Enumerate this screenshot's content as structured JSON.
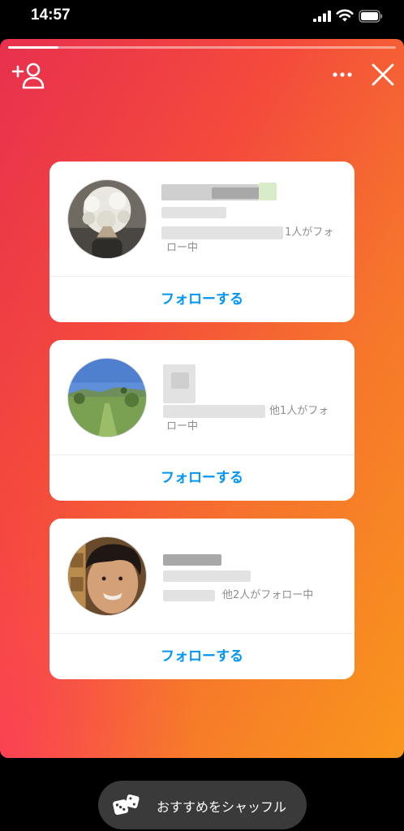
{
  "status_bar": {
    "time": "14:57"
  },
  "story": {
    "progress": 0.13,
    "icons": [
      "add-friend-icon",
      "more-icon",
      "close-icon"
    ]
  },
  "suggestions": [
    {
      "mutual_suffix": "1人がフォ",
      "mutual_wrap": "ロー中",
      "follow_label": "フォローする"
    },
    {
      "mutual_suffix": "他1人がフォ",
      "mutual_wrap": "ロー中",
      "follow_label": "フォローする"
    },
    {
      "mutual_suffix": "他2人がフォロー中",
      "follow_label": "フォローする"
    }
  ],
  "shuffle": {
    "label": "おすすめをシャッフル"
  },
  "colors": {
    "accent": "#0095f6",
    "gradient_start": "#e8304e",
    "gradient_end": "#f9961c"
  }
}
